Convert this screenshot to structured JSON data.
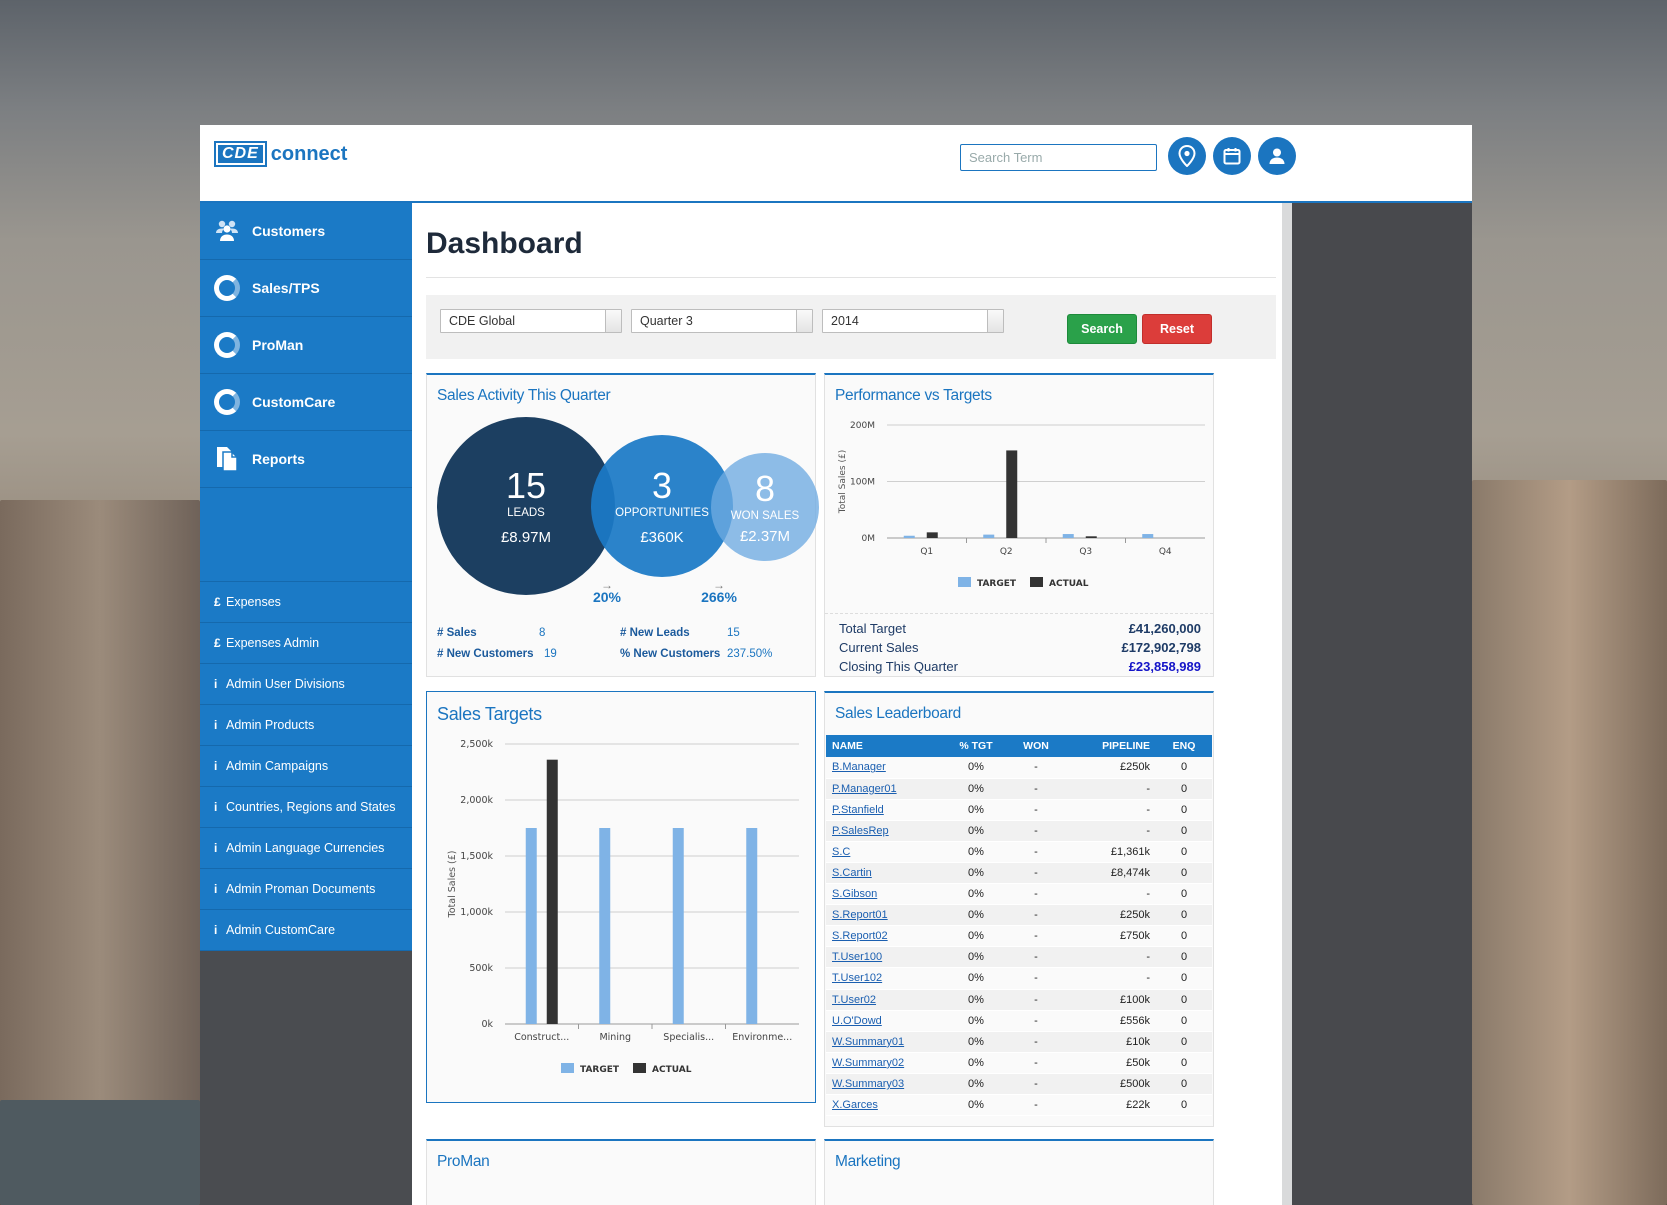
{
  "header": {
    "logo_mark": "CDE",
    "logo_text": "connect",
    "search_placeholder": "Search Term",
    "icons": [
      "location-pin-icon",
      "calendar-icon",
      "user-icon"
    ]
  },
  "sidebar": {
    "main_items": [
      {
        "label": "Customers",
        "icon": "users-icon"
      },
      {
        "label": "Sales/TPS",
        "icon": "ring-icon"
      },
      {
        "label": "ProMan",
        "icon": "ring-icon"
      },
      {
        "label": "CustomCare",
        "icon": "ring-icon"
      },
      {
        "label": "Reports",
        "icon": "document-icon"
      }
    ],
    "sub_items": [
      {
        "symbol": "£",
        "label": "Expenses"
      },
      {
        "symbol": "£",
        "label": "Expenses Admin"
      },
      {
        "symbol": "i",
        "label": "Admin User Divisions"
      },
      {
        "symbol": "i",
        "label": "Admin Products"
      },
      {
        "symbol": "i",
        "label": "Admin Campaigns"
      },
      {
        "symbol": "i",
        "label": "Countries, Regions and States"
      },
      {
        "symbol": "i",
        "label": "Admin Language Currencies"
      },
      {
        "symbol": "i",
        "label": "Admin Proman Documents"
      },
      {
        "symbol": "i",
        "label": "Admin CustomCare"
      }
    ]
  },
  "page": {
    "title": "Dashboard"
  },
  "filters": {
    "company": "CDE Global",
    "quarter": "Quarter 3",
    "year": "2014",
    "search_label": "Search",
    "reset_label": "Reset"
  },
  "sales_activity": {
    "title": "Sales Activity This Quarter",
    "bubbles": [
      {
        "number": "15",
        "label": "LEADS",
        "value": "£8.97M"
      },
      {
        "number": "3",
        "label": "OPPORTUNITIES",
        "value": "£360K"
      },
      {
        "number": "8",
        "label": "WON SALES",
        "value": "£2.37M"
      }
    ],
    "arrow": "→",
    "conversion": [
      "20%",
      "266%"
    ],
    "stats": [
      {
        "label": "# Sales",
        "value": "8"
      },
      {
        "label": "# New Leads",
        "value": "15"
      },
      {
        "label": "# New Customers",
        "value": "19"
      },
      {
        "label": "% New Customers",
        "value": "237.50%"
      }
    ]
  },
  "performance": {
    "title": "Performance vs Targets",
    "summary": [
      {
        "label": "Total Target",
        "value": "£41,260,000",
        "color": "#1e3b66"
      },
      {
        "label": "Current Sales",
        "value": "£172,902,798",
        "color": "#1e3b66"
      },
      {
        "label": "Closing This Quarter",
        "value": "£23,858,989",
        "color": "#1414c8"
      }
    ]
  },
  "sales_targets": {
    "title": "Sales Targets"
  },
  "leaderboard": {
    "title": "Sales Leaderboard",
    "columns": [
      "NAME",
      "% TGT",
      "WON",
      "PIPELINE",
      "ENQ"
    ],
    "rows": [
      [
        "B.Manager",
        "0%",
        "-",
        "£250k",
        "0"
      ],
      [
        "P.Manager01",
        "0%",
        "-",
        "-",
        "0"
      ],
      [
        "P.Stanfield",
        "0%",
        "-",
        "-",
        "0"
      ],
      [
        "P.SalesRep",
        "0%",
        "-",
        "-",
        "0"
      ],
      [
        "S.C",
        "0%",
        "-",
        "£1,361k",
        "0"
      ],
      [
        "S.Cartin",
        "0%",
        "-",
        "£8,474k",
        "0"
      ],
      [
        "S.Gibson",
        "0%",
        "-",
        "-",
        "0"
      ],
      [
        "S.Report01",
        "0%",
        "-",
        "£250k",
        "0"
      ],
      [
        "S.Report02",
        "0%",
        "-",
        "£750k",
        "0"
      ],
      [
        "T.User100",
        "0%",
        "-",
        "-",
        "0"
      ],
      [
        "T.User102",
        "0%",
        "-",
        "-",
        "0"
      ],
      [
        "T.User02",
        "0%",
        "-",
        "£100k",
        "0"
      ],
      [
        "U.O'Dowd",
        "0%",
        "-",
        "£556k",
        "0"
      ],
      [
        "W.Summary01",
        "0%",
        "-",
        "£10k",
        "0"
      ],
      [
        "W.Summary02",
        "0%",
        "-",
        "£50k",
        "0"
      ],
      [
        "W.Summary03",
        "0%",
        "-",
        "£500k",
        "0"
      ],
      [
        "X.Garces",
        "0%",
        "-",
        "£22k",
        "0"
      ]
    ]
  },
  "bottom_panels": [
    "ProMan",
    "Marketing"
  ],
  "colors": {
    "target": "#7fb3e6",
    "actual": "#333333",
    "accent": "#1b75c0"
  },
  "chart_data": [
    {
      "type": "bar",
      "categories": [
        "Q1",
        "Q2",
        "Q3",
        "Q4"
      ],
      "series": [
        {
          "name": "TARGET",
          "values": [
            4,
            6,
            7,
            7
          ]
        },
        {
          "name": "ACTUAL",
          "values": [
            10,
            155,
            3,
            0
          ]
        }
      ],
      "ylabel": "Total Sales (£)",
      "ylim": [
        0,
        200
      ],
      "yticks": [
        "0M",
        "100M",
        "200M"
      ],
      "grid": true,
      "legend": "bottom"
    },
    {
      "type": "bar",
      "categories": [
        "Construct...",
        "Mining",
        "Specialis...",
        "Environme..."
      ],
      "series": [
        {
          "name": "TARGET",
          "values": [
            1750,
            1750,
            1750,
            1750
          ]
        },
        {
          "name": "ACTUAL",
          "values": [
            2360,
            0,
            0,
            0
          ]
        }
      ],
      "ylabel": "Total Sales (£)",
      "ylim": [
        0,
        2500
      ],
      "yticks": [
        "0k",
        "500k",
        "1,000k",
        "1,500k",
        "2,000k",
        "2,500k"
      ],
      "grid": true,
      "legend": "bottom"
    }
  ]
}
